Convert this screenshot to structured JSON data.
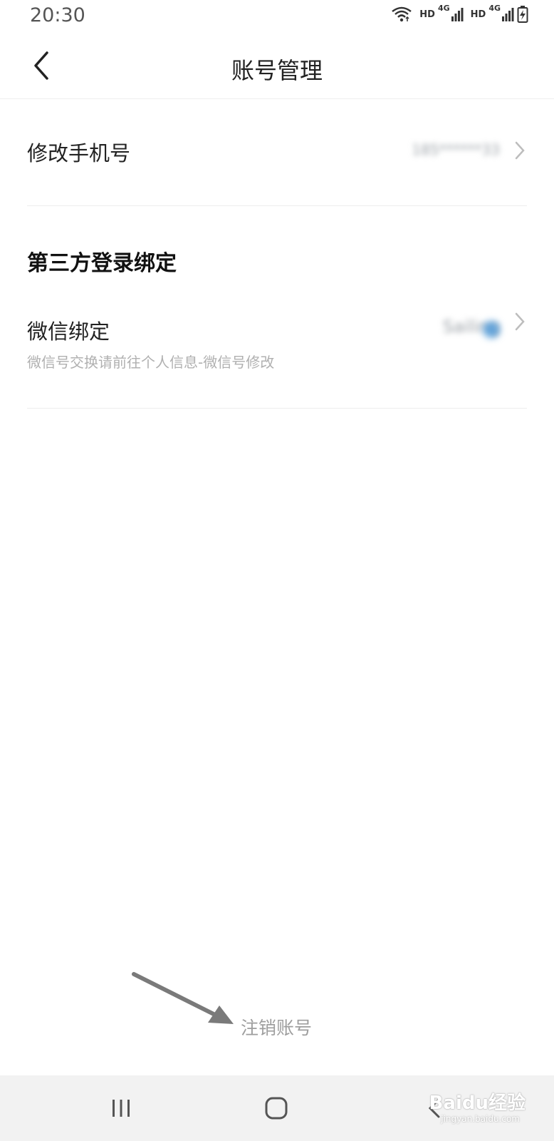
{
  "status_bar": {
    "time": "20:30",
    "hd_1": "HD",
    "net_1": "4G",
    "hd_2": "HD",
    "net_2": "4G"
  },
  "nav": {
    "title": "账号管理"
  },
  "phone_row": {
    "label": "修改手机号",
    "value_blurred": "185******33"
  },
  "third_party": {
    "section_title": "第三方登录绑定",
    "wechat_row": {
      "label": "微信绑定",
      "hint": "微信号交换请前往个人信息-微信号修改",
      "value_blurred": "Sailing"
    }
  },
  "footer": {
    "cancel_account": "注销账号"
  },
  "watermark": {
    "brand": "Baidu经验",
    "url": "jingyan.baidu.com"
  },
  "colors": {
    "divider": "#eeeeee",
    "hint_text": "#b0b0b0",
    "cancel_text": "#9e9e9e",
    "nav_background": "#f2f2f2"
  }
}
